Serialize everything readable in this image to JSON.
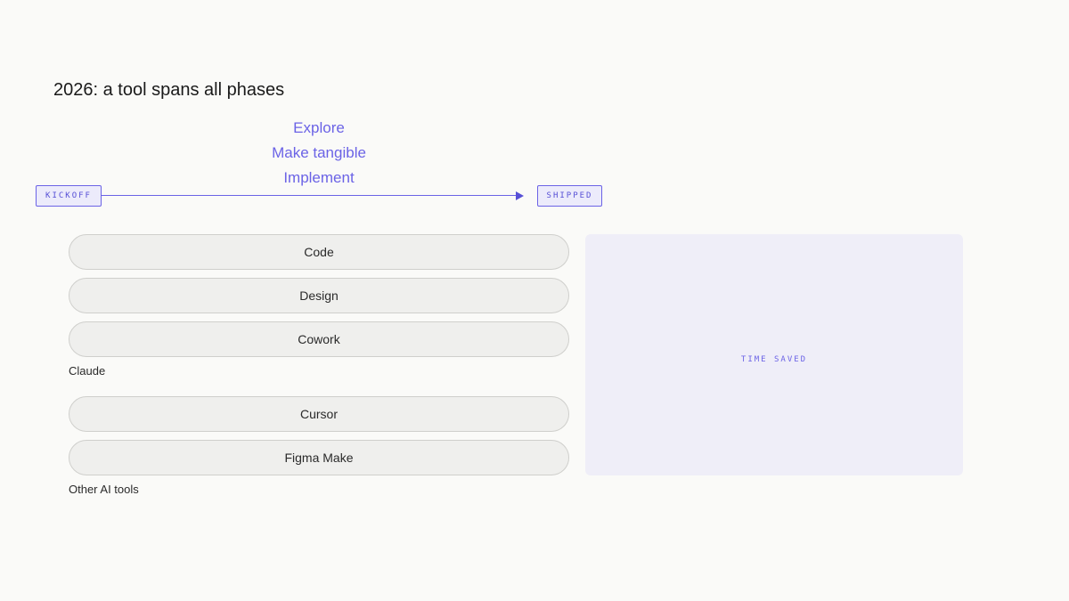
{
  "title": "2026: a tool spans all phases",
  "phases": [
    "Explore",
    "Make tangible",
    "Implement"
  ],
  "timeline": {
    "start_label": "KICKOFF",
    "end_label": "SHIPPED"
  },
  "groups": [
    {
      "label": "Claude",
      "tools": [
        "Code",
        "Design",
        "Cowork"
      ]
    },
    {
      "label": "Other AI tools",
      "tools": [
        "Cursor",
        "Figma Make"
      ]
    }
  ],
  "time_saved": {
    "label": "TIME SAVED"
  },
  "colors": {
    "accent": "#6b63e6",
    "panel": "#efeef8",
    "pill": "#efefed"
  }
}
